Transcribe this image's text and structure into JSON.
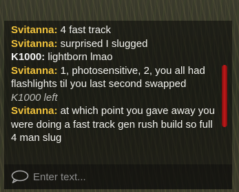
{
  "chat": {
    "messages": [
      {
        "type": "user",
        "sender": "Svitanna:",
        "text": " 4 fast track"
      },
      {
        "type": "user",
        "sender": "Svitanna:",
        "text": " surprised I slugged"
      },
      {
        "type": "user",
        "sender": "K1000:",
        "text": " lightborn lmao"
      },
      {
        "type": "user",
        "sender": "Svitanna:",
        "text": " 1, photosensitive, 2, you all had flashlights til you last second swapped"
      },
      {
        "type": "system",
        "text": "K1000 left"
      },
      {
        "type": "user",
        "sender": "Svitanna:",
        "text": " at which point you gave away you were doing a fast track gen rush build so full 4 man slug"
      }
    ],
    "input_placeholder": "Enter text..."
  },
  "colors": {
    "sender_primary": "#f0c23c",
    "sender_secondary": "#f2f2f2",
    "scrollbar": "#c21a1a"
  },
  "icons": {
    "input": "speech-bubble-icon"
  }
}
